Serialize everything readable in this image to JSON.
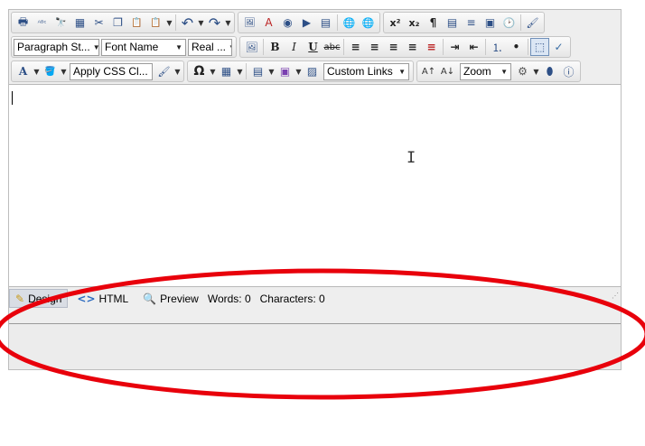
{
  "toolbar1": {
    "buttons": [
      {
        "name": "print-icon",
        "glyph": "🖶"
      },
      {
        "name": "spellcheck-icon",
        "glyph": "ᴬᴮᶜ"
      },
      {
        "name": "find-icon",
        "glyph": "🔭"
      },
      {
        "name": "select-all-icon",
        "glyph": "▦"
      },
      {
        "name": "cut-icon",
        "glyph": "✂"
      },
      {
        "name": "copy-icon",
        "glyph": "❐"
      },
      {
        "name": "paste-icon",
        "glyph": "📋"
      },
      {
        "name": "paste-special-icon",
        "glyph": "📋"
      },
      {
        "name": "undo-icon",
        "glyph": "↶"
      },
      {
        "name": "redo-icon",
        "glyph": "↷"
      },
      {
        "name": "insert-image-icon",
        "glyph": "🖼"
      },
      {
        "name": "insert-flash-icon",
        "glyph": "A"
      },
      {
        "name": "insert-media-icon",
        "glyph": "◉"
      },
      {
        "name": "insert-video-icon",
        "glyph": "▶"
      },
      {
        "name": "insert-document-icon",
        "glyph": "▤"
      },
      {
        "name": "hyperlink-icon",
        "glyph": "🌐"
      },
      {
        "name": "unlink-icon",
        "glyph": "🌐"
      },
      {
        "name": "superscript-icon",
        "glyph": "x²"
      },
      {
        "name": "subscript-icon",
        "glyph": "x₂"
      },
      {
        "name": "paragraph-icon",
        "glyph": "¶"
      },
      {
        "name": "template-icon",
        "glyph": "▤"
      },
      {
        "name": "align-icon",
        "glyph": "≡"
      },
      {
        "name": "form-icon",
        "glyph": "▣"
      },
      {
        "name": "time-icon",
        "glyph": "🕑"
      },
      {
        "name": "format-stripper-icon",
        "glyph": "🖌"
      }
    ]
  },
  "toolbar2": {
    "paragraph_style": "Paragraph St...",
    "font_name": "Font Name",
    "font_size": "Real ...",
    "buttons": [
      {
        "name": "image-manager-icon",
        "glyph": "🖼"
      },
      {
        "name": "bold-icon",
        "glyph": "B"
      },
      {
        "name": "italic-icon",
        "glyph": "I"
      },
      {
        "name": "underline-icon",
        "glyph": "U"
      },
      {
        "name": "strikethrough-icon",
        "glyph": "abc"
      },
      {
        "name": "align-left-icon",
        "glyph": "≡"
      },
      {
        "name": "align-center-icon",
        "glyph": "≡"
      },
      {
        "name": "align-right-icon",
        "glyph": "≡"
      },
      {
        "name": "justify-icon",
        "glyph": "≡"
      },
      {
        "name": "remove-alignment-icon",
        "glyph": "≡"
      },
      {
        "name": "indent-icon",
        "glyph": "⇥"
      },
      {
        "name": "outdent-icon",
        "glyph": "⇤"
      },
      {
        "name": "numbered-list-icon",
        "glyph": "⒈"
      },
      {
        "name": "bullet-list-icon",
        "glyph": "•"
      },
      {
        "name": "toggle-borders-icon",
        "glyph": "⬚"
      },
      {
        "name": "w3c-validate-icon",
        "glyph": "✓"
      }
    ]
  },
  "toolbar3": {
    "css_class": "Apply CSS Cl...",
    "custom_links": "Custom Links",
    "zoom": "Zoom",
    "buttons": [
      {
        "name": "font-color-icon",
        "glyph": "A"
      },
      {
        "name": "highlight-color-icon",
        "glyph": "🪣"
      },
      {
        "name": "format-painter-icon",
        "glyph": "🖌"
      },
      {
        "name": "symbol-icon",
        "glyph": "Ω"
      },
      {
        "name": "table-icon",
        "glyph": "▦"
      },
      {
        "name": "snippets-icon",
        "glyph": "▤"
      },
      {
        "name": "insert-form-element-icon",
        "glyph": "▣"
      },
      {
        "name": "page-properties-icon",
        "glyph": "▨"
      },
      {
        "name": "font-size-up-icon",
        "glyph": "A↑"
      },
      {
        "name": "font-size-down-icon",
        "glyph": "A↓"
      },
      {
        "name": "module-manager-icon",
        "glyph": "⚙"
      },
      {
        "name": "xhtml-validator-icon",
        "glyph": "⬮"
      },
      {
        "name": "about-icon",
        "glyph": "ⓘ"
      }
    ]
  },
  "modes": {
    "design": "Design",
    "html": "HTML",
    "preview": "Preview"
  },
  "stats": {
    "words": "Words: 0",
    "characters": "Characters: 0"
  },
  "colors": {
    "annotation": "#e8000b",
    "toolbar_icon": "#2d4f86"
  }
}
